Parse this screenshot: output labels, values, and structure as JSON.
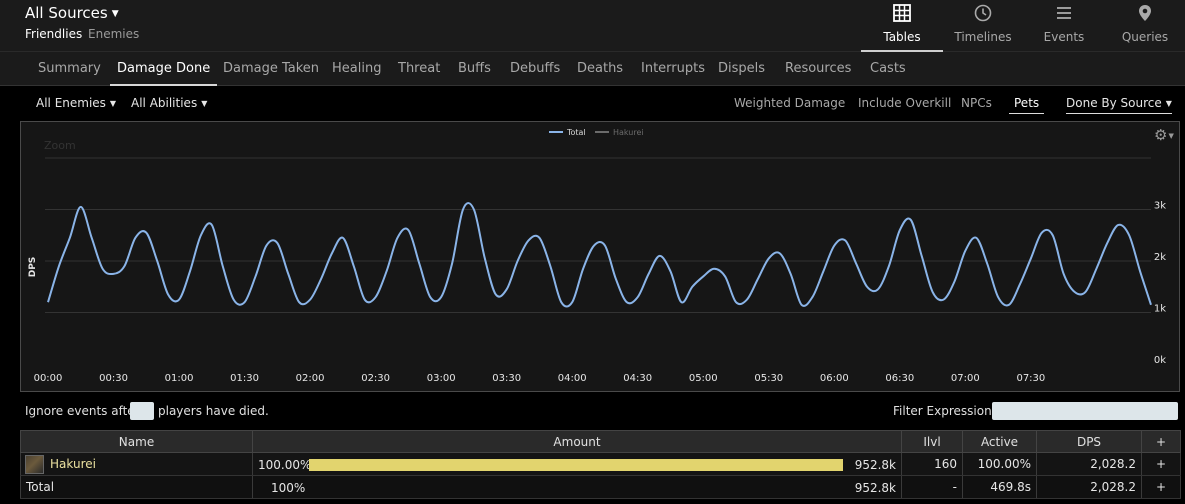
{
  "header": {
    "source_label": "All Sources",
    "friendlies_label": "Friendlies",
    "enemies_label": "Enemies",
    "views": [
      {
        "label": "Tables",
        "icon": "table-icon",
        "active": true
      },
      {
        "label": "Timelines",
        "icon": "clock-icon",
        "active": false
      },
      {
        "label": "Events",
        "icon": "list-icon",
        "active": false
      },
      {
        "label": "Queries",
        "icon": "map-pin-icon",
        "active": false
      }
    ]
  },
  "tabs": [
    {
      "label": "Summary",
      "active": false
    },
    {
      "label": "Damage Done",
      "active": true
    },
    {
      "label": "Damage Taken",
      "active": false
    },
    {
      "label": "Healing",
      "active": false
    },
    {
      "label": "Threat",
      "active": false
    },
    {
      "label": "Buffs",
      "active": false
    },
    {
      "label": "Debuffs",
      "active": false
    },
    {
      "label": "Deaths",
      "active": false
    },
    {
      "label": "Interrupts",
      "active": false
    },
    {
      "label": "Dispels",
      "active": false
    },
    {
      "label": "Resources",
      "active": false
    },
    {
      "label": "Casts",
      "active": false
    }
  ],
  "filters": {
    "enemies_dd": "All Enemies",
    "abilities_dd": "All Abilities",
    "options": [
      {
        "label": "Weighted Damage",
        "active": false
      },
      {
        "label": "Include Overkill",
        "active": false
      },
      {
        "label": "NPCs",
        "active": false
      },
      {
        "label": "Pets",
        "active": true
      }
    ],
    "done_by_dd": "Done By Source"
  },
  "chart": {
    "zoom_label": "Zoom"
  },
  "chart_data": {
    "type": "line",
    "ylabel": "DPS",
    "xlabel": "",
    "ylim": [
      0,
      3000
    ],
    "yticks": [
      0,
      1000,
      2000,
      3000
    ],
    "ytick_labels": [
      "0k",
      "1k",
      "2k",
      "3k"
    ],
    "xtick_labels": [
      "00:00",
      "00:30",
      "01:00",
      "01:30",
      "02:00",
      "02:30",
      "03:00",
      "03:30",
      "04:00",
      "04:30",
      "05:00",
      "05:30",
      "06:00",
      "06:30",
      "07:00",
      "07:30"
    ],
    "xlim_seconds": [
      0,
      505
    ],
    "legend": [
      "Total",
      "Hakurei"
    ],
    "legend_placement": "top-center",
    "series": [
      {
        "name": "Total",
        "color": "#8ab4e8",
        "x": [
          0,
          5,
          10,
          15,
          20,
          25,
          30,
          35,
          40,
          45,
          50,
          55,
          60,
          65,
          70,
          75,
          80,
          85,
          90,
          95,
          100,
          105,
          110,
          115,
          120,
          125,
          130,
          135,
          140,
          145,
          150,
          155,
          160,
          165,
          170,
          175,
          180,
          185,
          190,
          195,
          200,
          205,
          210,
          215,
          220,
          225,
          230,
          235,
          240,
          245,
          250,
          255,
          260,
          265,
          270,
          275,
          280,
          285,
          290,
          295,
          300,
          305,
          310,
          315,
          320,
          325,
          330,
          335,
          340,
          345,
          350,
          355,
          360,
          365,
          370,
          375,
          380,
          385,
          390,
          395,
          400,
          405,
          410,
          415,
          420,
          425,
          430,
          435,
          440,
          445,
          450,
          455,
          460,
          465,
          470,
          475,
          480,
          485,
          490,
          495,
          500,
          505
        ],
        "values": [
          1200,
          1900,
          2450,
          3050,
          2450,
          1850,
          1750,
          1900,
          2450,
          2550,
          2000,
          1350,
          1250,
          1800,
          2500,
          2700,
          1900,
          1250,
          1200,
          1700,
          2300,
          2350,
          1750,
          1200,
          1250,
          1650,
          2150,
          2450,
          1900,
          1250,
          1300,
          1800,
          2450,
          2600,
          1950,
          1300,
          1300,
          1950,
          3000,
          3000,
          2050,
          1350,
          1450,
          2000,
          2400,
          2450,
          1900,
          1200,
          1200,
          1850,
          2300,
          2300,
          1650,
          1200,
          1300,
          1750,
          2100,
          1800,
          1200,
          1500,
          1700,
          1850,
          1700,
          1200,
          1250,
          1650,
          2050,
          2150,
          1750,
          1150,
          1300,
          1800,
          2300,
          2400,
          1950,
          1500,
          1450,
          1900,
          2600,
          2800,
          2100,
          1400,
          1250,
          1600,
          2200,
          2450,
          1950,
          1300,
          1150,
          1550,
          2050,
          2550,
          2500,
          1750,
          1400,
          1400,
          1850,
          2350,
          2700,
          2500,
          1800,
          1150
        ]
      },
      {
        "name": "Hakurei",
        "color": "#6b6b6b",
        "values": []
      }
    ]
  },
  "ignore": {
    "prefix": "Ignore events after",
    "value": "",
    "suffix": "players have died."
  },
  "filter_expr": {
    "label": "Filter Expression:",
    "value": ""
  },
  "table": {
    "headers": [
      "Name",
      "Amount",
      "Ilvl",
      "Active",
      "DPS",
      "+"
    ],
    "rows": [
      {
        "name": "Hakurei",
        "pct": "100.00%",
        "bar_fraction": 1.0,
        "amount": "952.8k",
        "ilvl": "160",
        "active": "100.00%",
        "dps": "2,028.2",
        "plus": "+"
      }
    ],
    "total": {
      "name": "Total",
      "pct": "100%",
      "amount": "952.8k",
      "ilvl": "-",
      "active": "469.8s",
      "dps": "2,028.2",
      "plus": "+"
    },
    "bar_color": "#e2d46e",
    "name_color": "#ebe1a0"
  }
}
